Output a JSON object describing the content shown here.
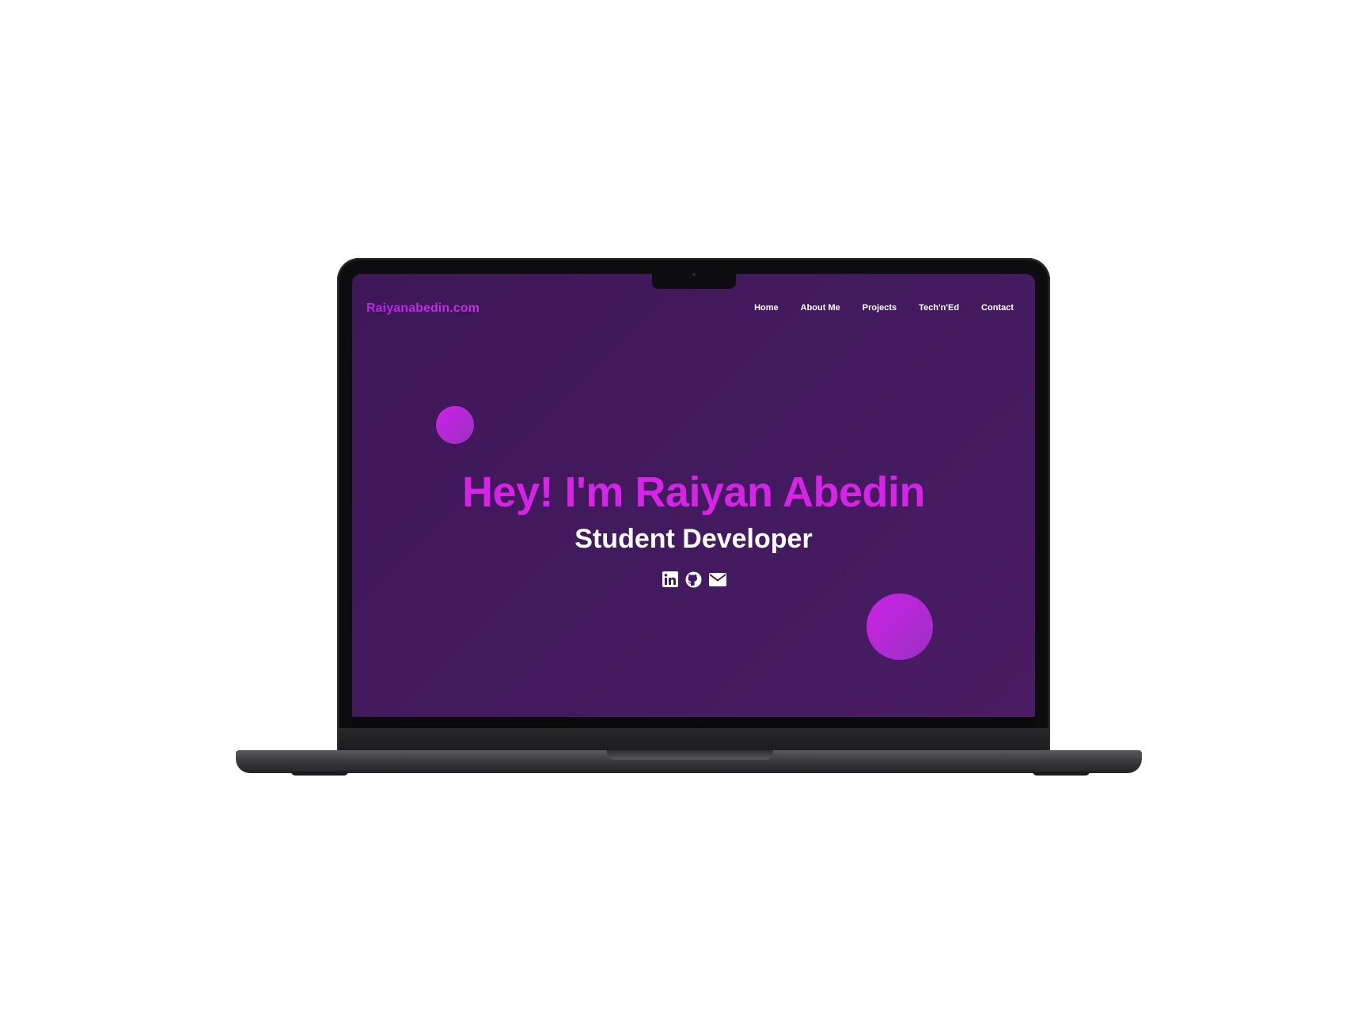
{
  "site": {
    "logo": "Raiyanabedin.com",
    "nav": [
      {
        "label": "Home"
      },
      {
        "label": "About Me"
      },
      {
        "label": "Projects"
      },
      {
        "label": "Tech'n'Ed"
      },
      {
        "label": "Contact"
      }
    ],
    "hero": {
      "title": "Hey! I'm Raiyan Abedin",
      "subtitle": "Student Developer"
    },
    "socials": [
      {
        "icon": "linkedin-icon"
      },
      {
        "icon": "github-icon"
      },
      {
        "icon": "email-icon"
      }
    ]
  },
  "colors": {
    "background": "#431a5f",
    "accent": "#d624e6",
    "logo": "#b329e0",
    "text": "#ffffff",
    "device": "#0d0d0f"
  }
}
